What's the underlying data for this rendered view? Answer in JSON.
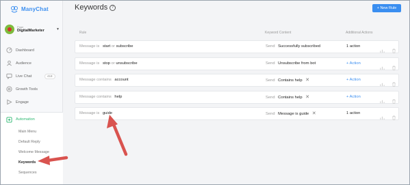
{
  "brand": {
    "name": "ManyChat"
  },
  "page": {
    "label": "Page",
    "name": "DigitalMarketer"
  },
  "nav": [
    {
      "label": "Dashboard",
      "icon": "dashboard-icon"
    },
    {
      "label": "Audience",
      "icon": "audience-icon"
    },
    {
      "label": "Live Chat",
      "icon": "livechat-icon",
      "badge": "418"
    },
    {
      "label": "Growth Tools",
      "icon": "growth-tools-icon"
    },
    {
      "label": "Engage",
      "icon": "engage-icon"
    },
    {
      "label": "Automation",
      "icon": "automation-icon"
    }
  ],
  "sub_nav": [
    "Main Menu",
    "Default Reply",
    "Welcome Message",
    "Keywords",
    "Sequences"
  ],
  "header": {
    "title": "Keywords",
    "help": "?",
    "new_rule": "+ New Rule"
  },
  "columns": {
    "rule": "Rule",
    "keyword_content": "Keyword Content",
    "additional_actions": "Additional Actions"
  },
  "rows": [
    {
      "cond": "Message is",
      "kw1": "start",
      "conj": "or",
      "kw2": "subscribe",
      "send": "Send",
      "content": "Successfully subscribed",
      "action": "1 action",
      "action_is_link": false,
      "removable": false
    },
    {
      "cond": "Message is",
      "kw1": "stop",
      "conj": "or",
      "kw2": "unsubscribe",
      "send": "Send",
      "content": "Unsubscribe from bot",
      "action": "+ Action",
      "action_is_link": true,
      "removable": false
    },
    {
      "cond": "Message contains",
      "kw1": "account",
      "conj": "",
      "kw2": "",
      "send": "Send",
      "content": "Contains help",
      "action": "+ Action",
      "action_is_link": true,
      "removable": true
    },
    {
      "cond": "Message contains",
      "kw1": "help",
      "conj": "",
      "kw2": "",
      "send": "Send",
      "content": "Contains help",
      "action": "+ Action",
      "action_is_link": true,
      "removable": true
    },
    {
      "cond": "Message is",
      "kw1": "guide",
      "conj": "",
      "kw2": "",
      "send": "Send",
      "content": "Message is guide",
      "action": "1 action",
      "action_is_link": false,
      "removable": true
    }
  ],
  "colors": {
    "accent": "#3a8ef0",
    "active": "#2eb872",
    "arrow": "#d9534f"
  }
}
